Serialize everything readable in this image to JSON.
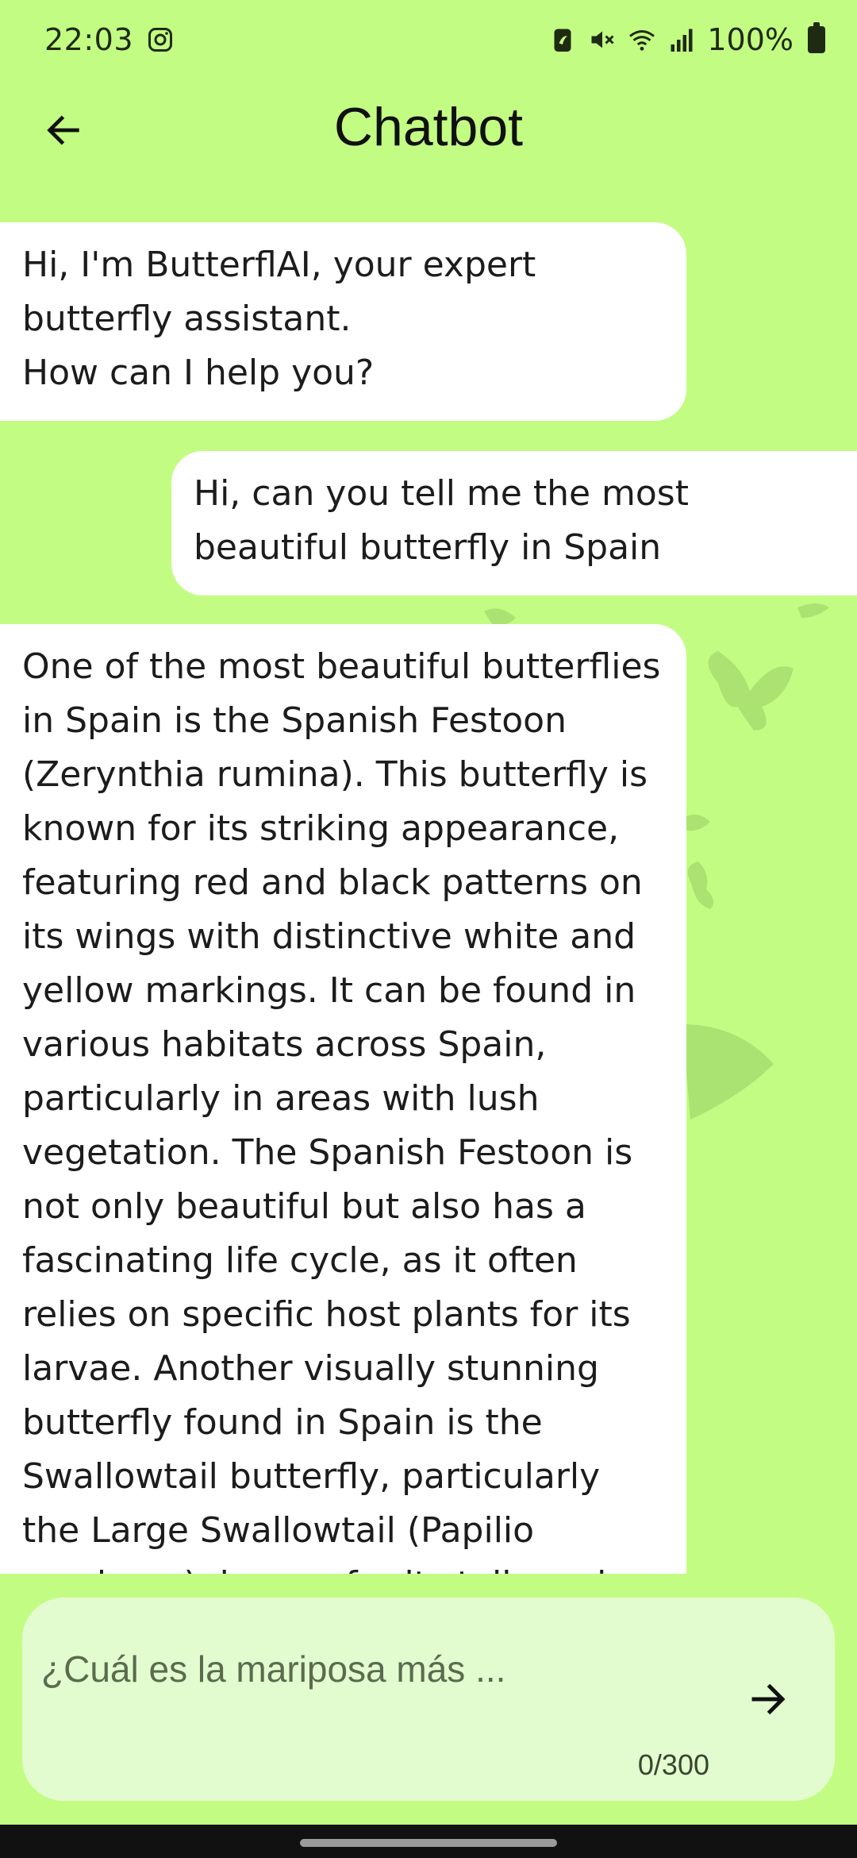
{
  "status_bar": {
    "time": "22:03",
    "battery_text": "100%",
    "icons": [
      "instagram-icon",
      "battery-saver-icon",
      "mute-icon",
      "wifi-icon",
      "signal-icon",
      "battery-icon"
    ]
  },
  "app_bar": {
    "title": "Chatbot",
    "back_icon": "arrow-left-icon"
  },
  "messages": [
    {
      "sender": "bot",
      "text": "Hi, I'm ButterflAI, your expert butterfly assistant.\nHow can I help you?"
    },
    {
      "sender": "user",
      "text": "Hi, can you tell me the most beautiful butterfly in Spain"
    },
    {
      "sender": "bot",
      "text": "One of the most beautiful butterflies in Spain is the Spanish Festoon (Zerynthia rumina). This butterfly is known for its striking appearance, featuring red and black patterns on its wings with distinctive white and yellow markings. It can be found in various habitats across Spain, particularly in areas with lush vegetation. The Spanish Festoon is not only beautiful but also has a fascinating life cycle, as it often relies on specific host plants for its larvae. Another visually stunning butterfly found in Spain is the Swallowtail butterfly, particularly the Large Swallowtail (Papilio machaon), known for its tails and vibrant yellow"
    }
  ],
  "input": {
    "placeholder": "¿Cuál es la mariposa más ...",
    "value": "",
    "counter": "0/300",
    "send_icon": "arrow-right-icon"
  },
  "colors": {
    "background": "#c3fc83",
    "bubble": "#ffffff",
    "input_card": "#e3fccf",
    "butterfly_watermark": "#9fd56a"
  }
}
